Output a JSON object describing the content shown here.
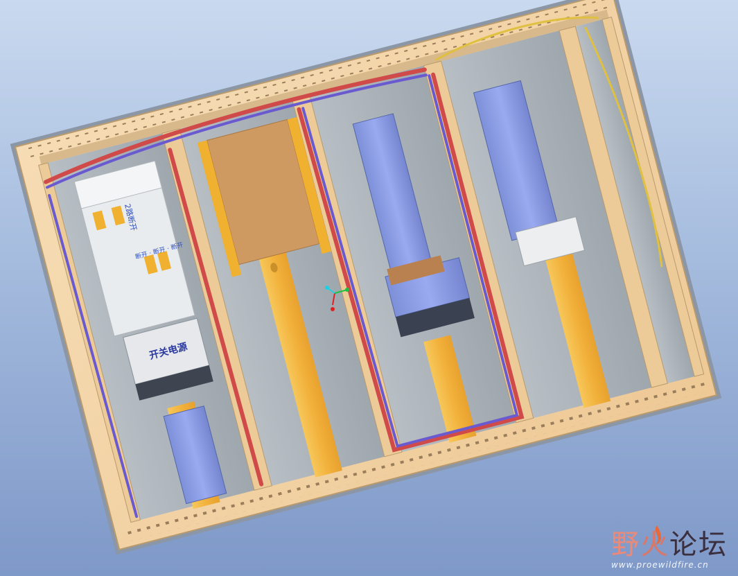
{
  "canvas": {
    "background_top": "#c9d9ef",
    "background_bottom": "#7e98c8"
  },
  "device_labels": {
    "breaker_tag": "2路断开",
    "breaker_row": "断开 · 断开 · 断开",
    "switch_block": "开关电源"
  },
  "coord_axes": {
    "x_color": "#e02020",
    "y_color": "#20c040",
    "z_color": "#20d0e0"
  },
  "colors": {
    "plate": "#f1d3a5",
    "rail": "#f5b94a",
    "terminal": "#8c9fe0",
    "wire_red": "#d04a4a",
    "wire_blue": "#6a5ad0",
    "wire_yellow": "#e0c040",
    "duct": "#a9b0b6"
  },
  "watermark": {
    "chars": [
      "野",
      "火",
      "论",
      "坛"
    ],
    "url": "www.proewildfire.cn"
  }
}
